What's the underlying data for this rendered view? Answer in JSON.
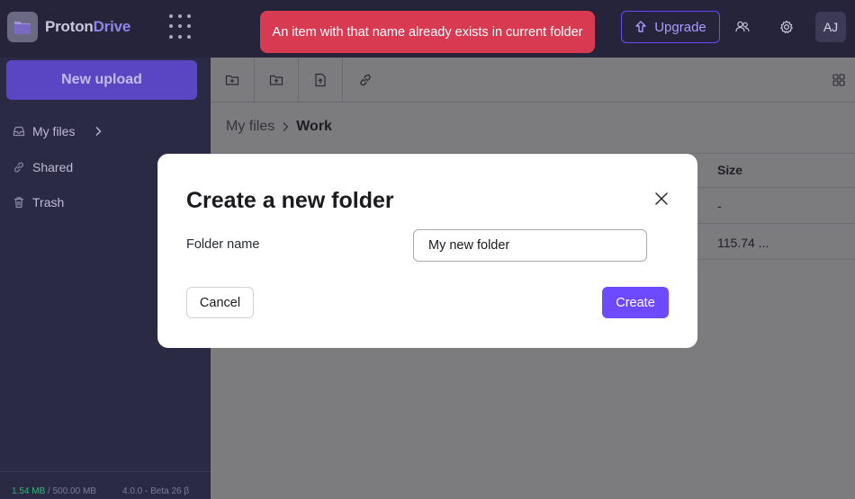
{
  "app": {
    "logo_part1": "Proton",
    "logo_part2": "Drive"
  },
  "header": {
    "upgrade_label": "Upgrade",
    "avatar_initials": "AJ"
  },
  "toast": {
    "message": "An item with that name already exists in current folder",
    "color": "#d83a52"
  },
  "sidebar": {
    "new_upload_label": "New upload",
    "items": [
      {
        "label": "My files",
        "icon": "inbox-icon"
      },
      {
        "label": "Shared",
        "icon": "link-icon"
      },
      {
        "label": "Trash",
        "icon": "trash-icon"
      }
    ],
    "storage_used": "1.54 MB",
    "storage_total": " / 500.00 MB",
    "version": "4.0.0 - Beta 26 β"
  },
  "main": {
    "breadcrumb": [
      "My files",
      "Work"
    ],
    "size_header": "Size",
    "rows": [
      {
        "size": "-"
      },
      {
        "size": "115.74 ..."
      }
    ]
  },
  "modal": {
    "title": "Create a new folder",
    "field_label": "Folder name",
    "field_value": "My new folder",
    "cancel_label": "Cancel",
    "create_label": "Create"
  },
  "colors": {
    "accent": "#6d4aff",
    "sidebar_bg": "#2b2a44",
    "error": "#d83a52"
  }
}
